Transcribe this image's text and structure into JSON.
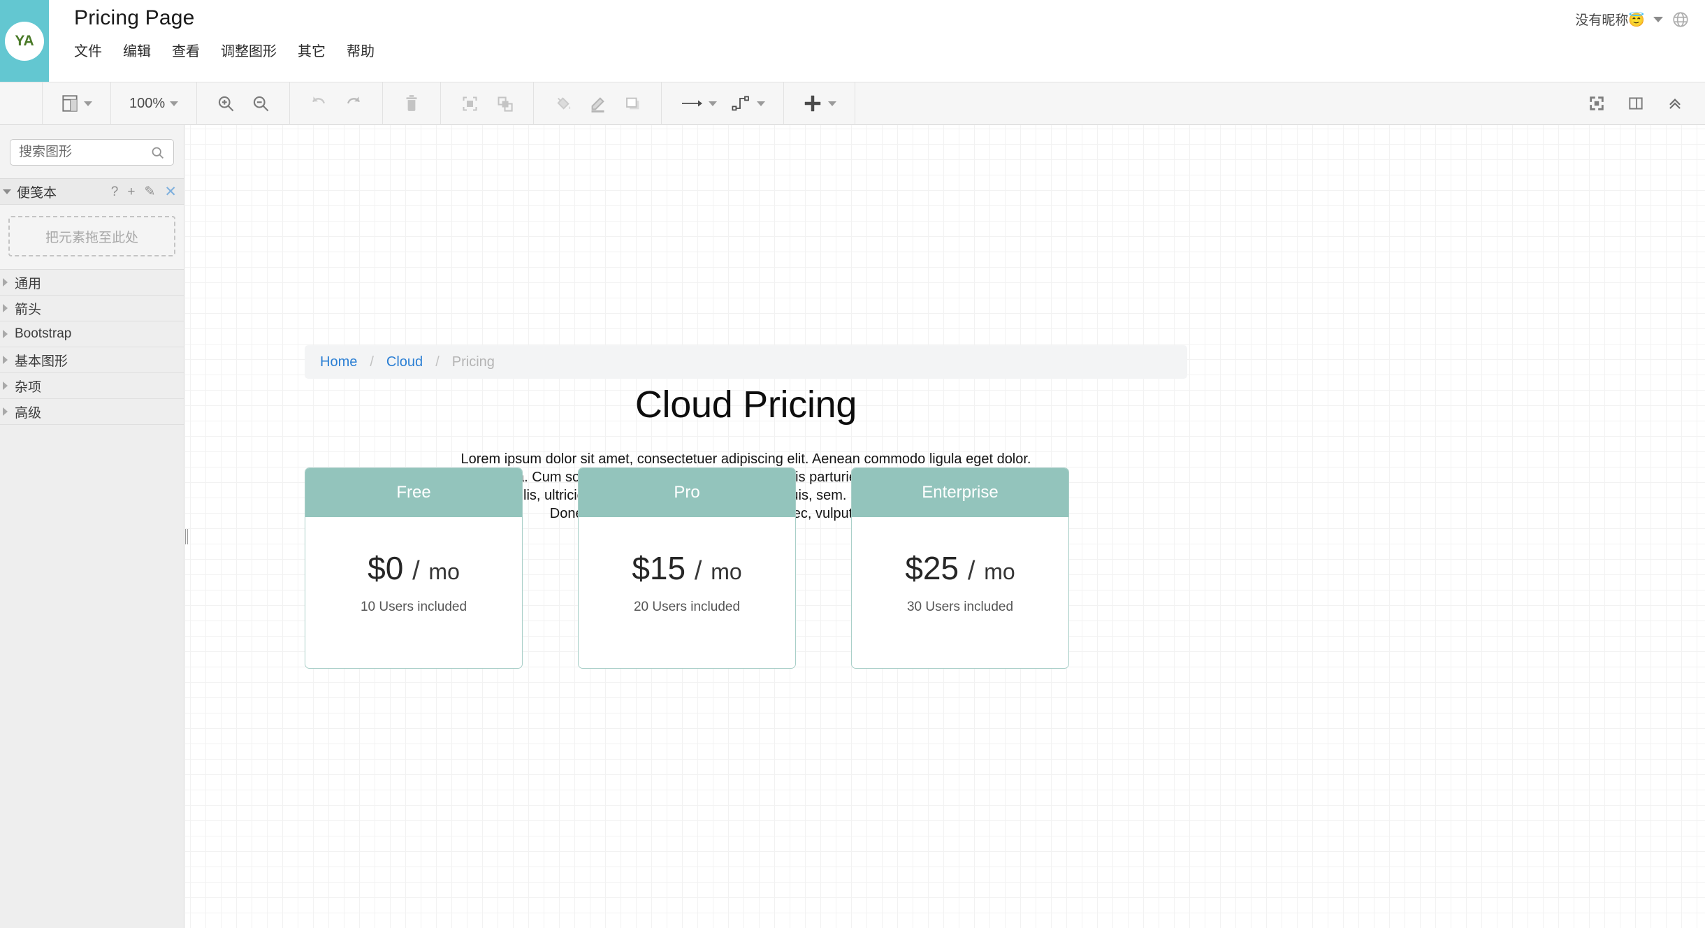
{
  "header": {
    "logo_text": "YA",
    "logo_bg": "#63c7d1",
    "logo_fg": "#4a7a28",
    "doc_title": "Pricing Page",
    "menu": [
      {
        "label": "文件"
      },
      {
        "label": "编辑"
      },
      {
        "label": "查看"
      },
      {
        "label": "调整图形"
      },
      {
        "label": "其它"
      },
      {
        "label": "帮助"
      }
    ],
    "user_name": "没有昵称😇",
    "language_icon": "globe-icon"
  },
  "toolbar": {
    "view_layout_icon": "panel-layout-icon",
    "zoom_level": "100%",
    "zoom_in_icon": "zoom-in-icon",
    "zoom_out_icon": "zoom-out-icon",
    "undo_icon": "undo-icon",
    "redo_icon": "redo-icon",
    "delete_icon": "trash-icon",
    "to_front_icon": "bring-to-front-icon",
    "to_back_icon": "send-to-back-icon",
    "fill_icon": "fill-color-icon",
    "line_icon": "line-color-icon",
    "shadow_icon": "shadow-icon",
    "arrow_icon": "arrow-style-icon",
    "waypoint_icon": "waypoint-style-icon",
    "insert_icon": "plus-icon",
    "fullscreen_icon": "fit-page-icon",
    "format_panel_icon": "format-panel-icon",
    "collapse_icon": "chevron-up-icon"
  },
  "sidebar": {
    "search_placeholder": "搜索图形",
    "search_value": "",
    "search_icon": "search-icon",
    "scratchpad": {
      "title": "便笺本",
      "help_label": "?",
      "add_label": "+",
      "edit_label": "✎",
      "close_label": "✕",
      "dropzone_text": "把元素拖至此处"
    },
    "categories": [
      {
        "label": "通用"
      },
      {
        "label": "箭头"
      },
      {
        "label": "Bootstrap"
      },
      {
        "label": "基本图形"
      },
      {
        "label": "杂项"
      },
      {
        "label": "高级"
      }
    ]
  },
  "canvas": {
    "breadcrumb": {
      "items": [
        {
          "label": "Home",
          "active": false
        },
        {
          "label": "Cloud",
          "active": false
        },
        {
          "label": "Pricing",
          "active": true
        }
      ],
      "separator": "/",
      "link_color": "#2b7fd4",
      "active_color": "#b4b4b4"
    },
    "page_title": "Cloud Pricing",
    "lead_lines": [
      "Lorem ipsum dolor sit amet, consectetuer adipiscing elit. Aenean commodo ligula eget dolor.",
      "Aenean massa. Cum sociis natoque penatibus et magnis dis parturient montes, ascetur ridiculus mus.",
      "Donec quam felis, ultricies nec, pellentesque eu, pretium quis, sem. Nulla consequat massa quis enim.",
      "Donec pede justo, fringilla vel, aliquet nec, vulputate eget, arcu."
    ],
    "accent_color": "#93c4bc",
    "card_border_color": "#a9cfc8",
    "pricing_cards": [
      {
        "name": "Free",
        "price_amount": "$0",
        "price_slash": "/",
        "price_unit": "mo",
        "users": "10 Users included"
      },
      {
        "name": "Pro",
        "price_amount": "$15",
        "price_slash": "/",
        "price_unit": "mo",
        "users": "20 Users included"
      },
      {
        "name": "Enterprise",
        "price_amount": "$25",
        "price_slash": "/",
        "price_unit": "mo",
        "users": "30 Users included"
      }
    ]
  }
}
